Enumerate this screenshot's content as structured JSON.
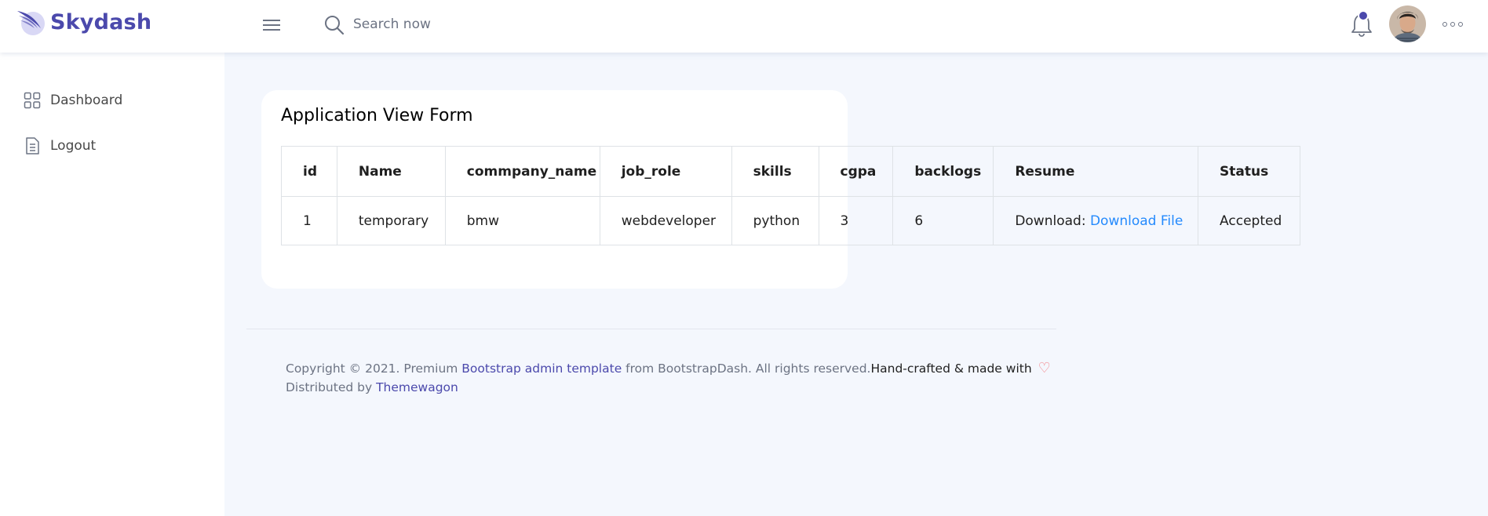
{
  "brand": {
    "name": "Skydash"
  },
  "search": {
    "placeholder": "Search now"
  },
  "icons": {
    "menu": "hamburger-icon",
    "search": "search-icon",
    "bell": "bell-icon",
    "more": "more-horizontal-icon",
    "dashboard": "grid-icon",
    "logout": "document-icon",
    "heart": "heart-icon"
  },
  "colors": {
    "accent": "#4B49AC",
    "link": "#248AFD",
    "heart": "#F3797E",
    "background": "#F4F7FD"
  },
  "sidebar": {
    "items": [
      {
        "label": "Dashboard"
      },
      {
        "label": "Logout"
      }
    ]
  },
  "card": {
    "title": "Application View Form"
  },
  "table": {
    "headers": [
      "id",
      "Name",
      "commpany_name",
      "job_role",
      "skills",
      "cgpa",
      "backlogs",
      "Resume",
      "Status"
    ],
    "rows": [
      {
        "id": "1",
        "name": "temporary",
        "company": "bmw",
        "job_role": "webdeveloper",
        "skills": "python",
        "cgpa": "3",
        "backlogs": "6",
        "resume_prefix": "Download: ",
        "resume_link": "Download File",
        "status": "Accepted"
      }
    ]
  },
  "footer": {
    "copyright_prefix": "Copyright © 2021. Premium ",
    "template_link": "Bootstrap admin template",
    "copyright_suffix": " from BootstrapDash. All rights reserved.",
    "handcrafted": "Hand-crafted & made with",
    "heart": "♡",
    "distributed_prefix": "Distributed by ",
    "distributed_link": "Themewagon"
  }
}
